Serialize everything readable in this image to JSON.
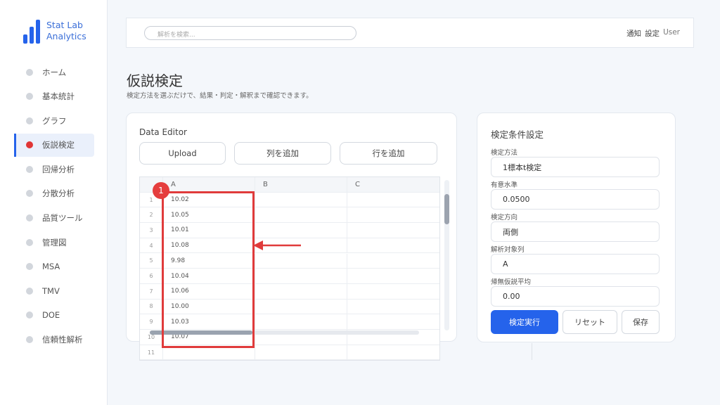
{
  "brand": {
    "name": "Stat Lab Analytics",
    "icon": "bar-chart-logo-icon"
  },
  "sidebar": {
    "items": [
      {
        "label": "ホーム",
        "active": false
      },
      {
        "label": "基本統計",
        "active": false
      },
      {
        "label": "グラフ",
        "active": false
      },
      {
        "label": "仮説検定",
        "active": true
      },
      {
        "label": "回帰分析",
        "active": false
      },
      {
        "label": "分散分析",
        "active": false
      },
      {
        "label": "品質ツール",
        "active": false
      },
      {
        "label": "管理図",
        "active": false
      },
      {
        "label": "MSA",
        "active": false
      },
      {
        "label": "TMV",
        "active": false
      },
      {
        "label": "DOE",
        "active": false
      },
      {
        "label": "信頼性解析",
        "active": false
      }
    ]
  },
  "topbar": {
    "search_placeholder": "解析を検索...",
    "notifications": "通知",
    "settings": "設定",
    "user": "User"
  },
  "page": {
    "title": "仮説検定",
    "subtitle": "検定方法を選ぶだけで、結果・判定・解釈まで確認できます。"
  },
  "editor": {
    "title": "Data Editor",
    "upload_label": "Upload",
    "add_column_label": "列を追加",
    "add_row_label": "行を追加",
    "columns": [
      "A",
      "B",
      "C"
    ],
    "rows": [
      {
        "n": "1",
        "a": "10.02",
        "b": "",
        "c": ""
      },
      {
        "n": "2",
        "a": "10.05",
        "b": "",
        "c": ""
      },
      {
        "n": "3",
        "a": "10.01",
        "b": "",
        "c": ""
      },
      {
        "n": "4",
        "a": "10.08",
        "b": "",
        "c": ""
      },
      {
        "n": "5",
        "a": "9.98",
        "b": "",
        "c": ""
      },
      {
        "n": "6",
        "a": "10.04",
        "b": "",
        "c": ""
      },
      {
        "n": "7",
        "a": "10.06",
        "b": "",
        "c": ""
      },
      {
        "n": "8",
        "a": "10.00",
        "b": "",
        "c": ""
      },
      {
        "n": "9",
        "a": "10.03",
        "b": "",
        "c": ""
      },
      {
        "n": "10",
        "a": "10.07",
        "b": "",
        "c": ""
      },
      {
        "n": "11",
        "a": "",
        "b": "",
        "c": ""
      }
    ]
  },
  "annotation": {
    "badge": "1",
    "color": "#e03b3b"
  },
  "settings": {
    "title": "検定条件設定",
    "method_label": "検定方法",
    "method_value": "1標本t検定",
    "alpha_label": "有意水準",
    "alpha_value": "0.0500",
    "direction_label": "検定方向",
    "direction_value": "両側",
    "target_label": "解析対象列",
    "target_value": "A",
    "null_mean_label": "帰無仮説平均",
    "null_mean_value": "0.00",
    "run_label": "検定実行",
    "reset_label": "リセット",
    "save_label": "保存"
  },
  "colors": {
    "accent": "#2563eb",
    "active_dot": "#e03535",
    "annotation": "#e03b3b"
  }
}
